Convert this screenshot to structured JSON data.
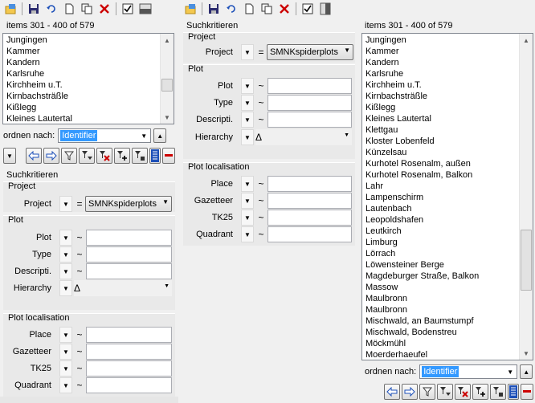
{
  "toolbar": {
    "buttons": [
      {
        "name": "open-icon"
      },
      {
        "name": "save-icon"
      },
      {
        "name": "undo-icon"
      },
      {
        "name": "new-icon"
      },
      {
        "name": "copy-icon"
      },
      {
        "name": "delete-icon"
      },
      {
        "name": "checkbox-icon"
      },
      {
        "name": "panel-icon"
      }
    ]
  },
  "list": {
    "range_label": "items 301 - 400 of 579",
    "left_items": [
      "Jungingen",
      "Kammer",
      "Kandern",
      "Karlsruhe",
      "Kirchheim u.T.",
      "Kirnbachsträßle",
      "Kißlegg",
      "Kleines Lautertal"
    ],
    "right_items": [
      "Jungingen",
      "Kammer",
      "Kandern",
      "Karlsruhe",
      "Kirchheim u.T.",
      "Kirnbachsträßle",
      "Kißlegg",
      "Kleines Lautertal",
      "Klettgau",
      "Kloster Lobenfeld",
      "Künzelsau",
      "Kurhotel Rosenalm, außen",
      "Kurhotel Rosenalm, Balkon",
      "Lahr",
      "Lampenschirm",
      "Lautenbach",
      "Leopoldshafen",
      "Leutkirch",
      "Limburg",
      "Lörrach",
      "Löwensteiner Berge",
      "Magdeburger Straße, Balkon",
      "Massow",
      "Maulbronn",
      "Maulbronn",
      "Mischwald, an Baumstumpf",
      "Mischwald, Bodenstreu",
      "Möckmühl",
      "Moerderhaeufel"
    ]
  },
  "order": {
    "label": "ordnen nach:",
    "value": "Identifier"
  },
  "search": {
    "title": "Suchkritieren",
    "project_group": "Project",
    "project_label": "Project",
    "project_op": "=",
    "project_value": "SMNKspiderplots",
    "plot_group": "Plot",
    "plot_fields": [
      {
        "label": "Plot",
        "op": "~"
      },
      {
        "label": "Type",
        "op": "~"
      },
      {
        "label": "Descripti.",
        "op": "~"
      }
    ],
    "hierarchy_label": "Hierarchy",
    "hierarchy_value": "Δ",
    "loc_group": "Plot localisation",
    "loc_fields": [
      {
        "label": "Place",
        "op": "~"
      },
      {
        "label": "Gazetteer",
        "op": "~"
      },
      {
        "label": "TK25",
        "op": "~"
      },
      {
        "label": "Quadrant",
        "op": "~"
      }
    ]
  },
  "colors": {
    "accent": "#3399ff",
    "delete": "#cc0000"
  }
}
